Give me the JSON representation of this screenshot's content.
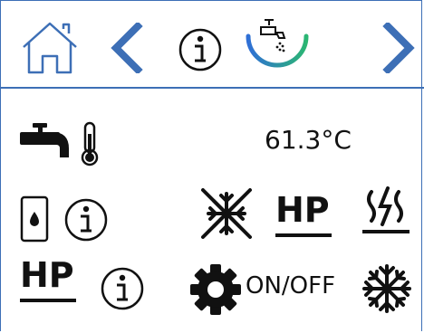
{
  "nav": {
    "home": "home-icon",
    "back": "chevron-left-icon",
    "info": "info-icon",
    "mode": "hot-water-tap-icon",
    "forward": "chevron-right-icon",
    "accent_color": "#3d6fb6"
  },
  "rows": {
    "hot_water_temp": {
      "icon": "tap-thermometer-icon",
      "value": "61.3°C"
    },
    "tank": {
      "icon": "water-tank-icon",
      "info": "info-icon"
    },
    "modes": {
      "defrost_off": "defrost-off-icon",
      "heat_pump_label": "HP",
      "electric_heater": "electric-heater-icon"
    },
    "hp_info": {
      "label": "HP",
      "info": "info-icon"
    },
    "settings": {
      "icon": "gear-icon",
      "label": "ON/OFF",
      "snow": "snowflake-icon"
    }
  },
  "gauge": {
    "start_color": "#2f6fd6",
    "end_color": "#2bb673"
  }
}
